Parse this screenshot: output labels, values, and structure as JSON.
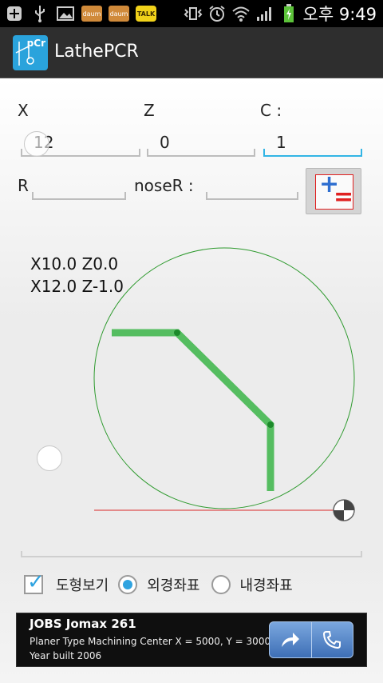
{
  "status_bar": {
    "badge1": "daum",
    "badge2": "daum",
    "talk": "TALK",
    "time": "오후 9:49"
  },
  "app": {
    "icon_text": "pCr",
    "title": "LathePCR"
  },
  "inputs": {
    "x_label": "X",
    "z_label": "Z",
    "c_label": "C :",
    "x_value": "12",
    "z_value": "0",
    "c_value": "1",
    "r_label": "R",
    "r_value": "",
    "nose_label": "noseR :",
    "nose_value": ""
  },
  "calc_button": {
    "plus": "+",
    "equals": "="
  },
  "readout": {
    "line1": "X10.0 Z0.0",
    "line2": "X12.0 Z-1.0"
  },
  "options": {
    "show_shape_label": "도형보기",
    "show_shape_checked": true,
    "outer_label": "외경좌표",
    "outer_selected": true,
    "inner_label": "내경좌표",
    "inner_selected": false
  },
  "ad": {
    "title": "JOBS Jomax 261",
    "description": "Planer Type Machining Center X = 5000, Y = 3000, Year built 2006"
  },
  "colors": {
    "path_green": "#3bb548",
    "circle_green": "#2e9a2e",
    "axis_red": "#e06a6a",
    "accent_blue": "#33b5e5",
    "actionbar": "#2e2e2e"
  }
}
